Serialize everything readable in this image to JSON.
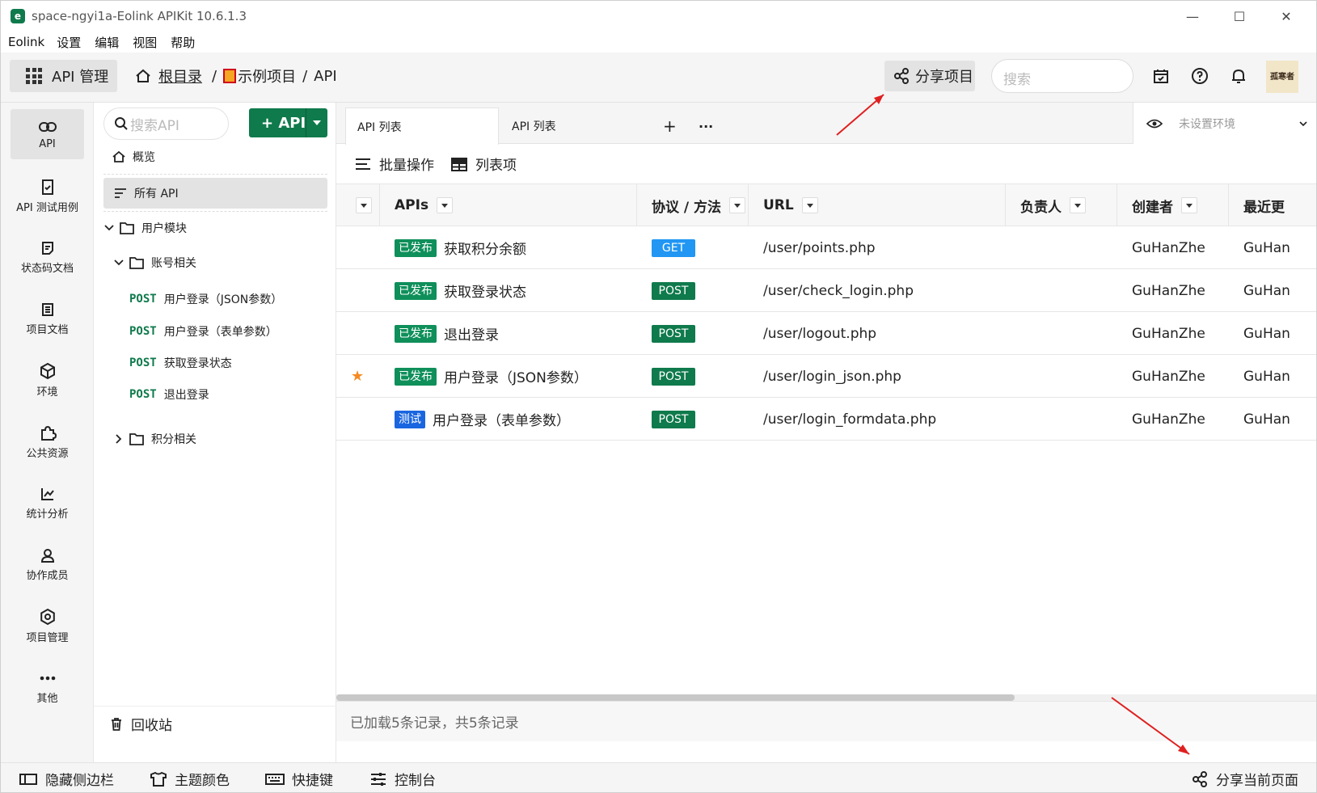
{
  "window": {
    "title": "space-ngyi1a-Eolink APIKit 10.6.1.3",
    "minimize": "—",
    "maximize": "☐",
    "close": "✕"
  },
  "menu": [
    "Eolink",
    "设置",
    "编辑",
    "视图",
    "帮助"
  ],
  "toolbar": {
    "module": "API 管理",
    "breadcrumb": {
      "root": "根目录",
      "sep1": "/",
      "project": "示例项目",
      "sep2": "/",
      "current": "API"
    },
    "share_project": "分享项目",
    "search_placeholder": "搜索",
    "avatar_text": "孤寒者"
  },
  "rail": [
    {
      "label": "API",
      "icon": "link-icon",
      "active": true
    },
    {
      "label": "API 测试用例",
      "icon": "clipboard-icon"
    },
    {
      "label": "状态码文档",
      "icon": "note-icon"
    },
    {
      "label": "项目文档",
      "icon": "document-icon"
    },
    {
      "label": "环境",
      "icon": "cube-icon"
    },
    {
      "label": "公共资源",
      "icon": "puzzle-icon"
    },
    {
      "label": "统计分析",
      "icon": "chart-icon"
    },
    {
      "label": "协作成员",
      "icon": "user-icon"
    },
    {
      "label": "项目管理",
      "icon": "gear-icon"
    },
    {
      "label": "其他",
      "icon": "more-icon"
    }
  ],
  "tree": {
    "search_placeholder": "搜索API",
    "add_label": "+ API",
    "overview": "概览",
    "all_api": "所有 API",
    "groups": {
      "user_module": "用户模块",
      "account": "账号相关",
      "points": "积分相关"
    },
    "apis": [
      {
        "method": "POST",
        "name": "用户登录（JSON参数）"
      },
      {
        "method": "POST",
        "name": "用户登录（表单参数）"
      },
      {
        "method": "POST",
        "name": "获取登录状态"
      },
      {
        "method": "POST",
        "name": "退出登录"
      }
    ],
    "recycle": "回收站"
  },
  "tabs": {
    "tab1": "API 列表",
    "tab2": "API 列表",
    "add": "+",
    "more": "···",
    "env": "未设置环境"
  },
  "actions": {
    "batch": "批量操作",
    "columns": "列表项"
  },
  "table": {
    "headers": {
      "apis": "APIs",
      "protocol": "协议 / 方法",
      "url": "URL",
      "owner": "负责人",
      "creator": "创建者",
      "updated": "最近更"
    },
    "rows": [
      {
        "star": "",
        "status": "已发布",
        "status_type": "pub",
        "name": "获取积分余额",
        "method": "GET",
        "url": "/user/points.php",
        "owner": "",
        "creator": "GuHanZhe",
        "updated": "GuHan"
      },
      {
        "star": "",
        "status": "已发布",
        "status_type": "pub",
        "name": "获取登录状态",
        "method": "POST",
        "url": "/user/check_login.php",
        "owner": "",
        "creator": "GuHanZhe",
        "updated": "GuHan"
      },
      {
        "star": "",
        "status": "已发布",
        "status_type": "pub",
        "name": "退出登录",
        "method": "POST",
        "url": "/user/logout.php",
        "owner": "",
        "creator": "GuHanZhe",
        "updated": "GuHan"
      },
      {
        "star": "★",
        "status": "已发布",
        "status_type": "pub",
        "name": "用户登录（JSON参数）",
        "method": "POST",
        "url": "/user/login_json.php",
        "owner": "",
        "creator": "GuHanZhe",
        "updated": "GuHan"
      },
      {
        "star": "",
        "status": "测试",
        "status_type": "test",
        "name": "用户登录（表单参数）",
        "method": "POST",
        "url": "/user/login_formdata.php",
        "owner": "",
        "creator": "GuHanZhe",
        "updated": "GuHan"
      }
    ],
    "footer": "已加载5条记录，共5条记录"
  },
  "statusbar": {
    "hide_sidebar": "隐藏侧边栏",
    "theme": "主题颜色",
    "shortcuts": "快捷键",
    "console": "控制台",
    "share_page": "分享当前页面"
  },
  "colors": {
    "brand_green": "#0f7a4c",
    "get_blue": "#2196f3",
    "test_blue": "#1a66e0",
    "star_orange": "#f5891f",
    "annotation_red": "#e02020"
  }
}
